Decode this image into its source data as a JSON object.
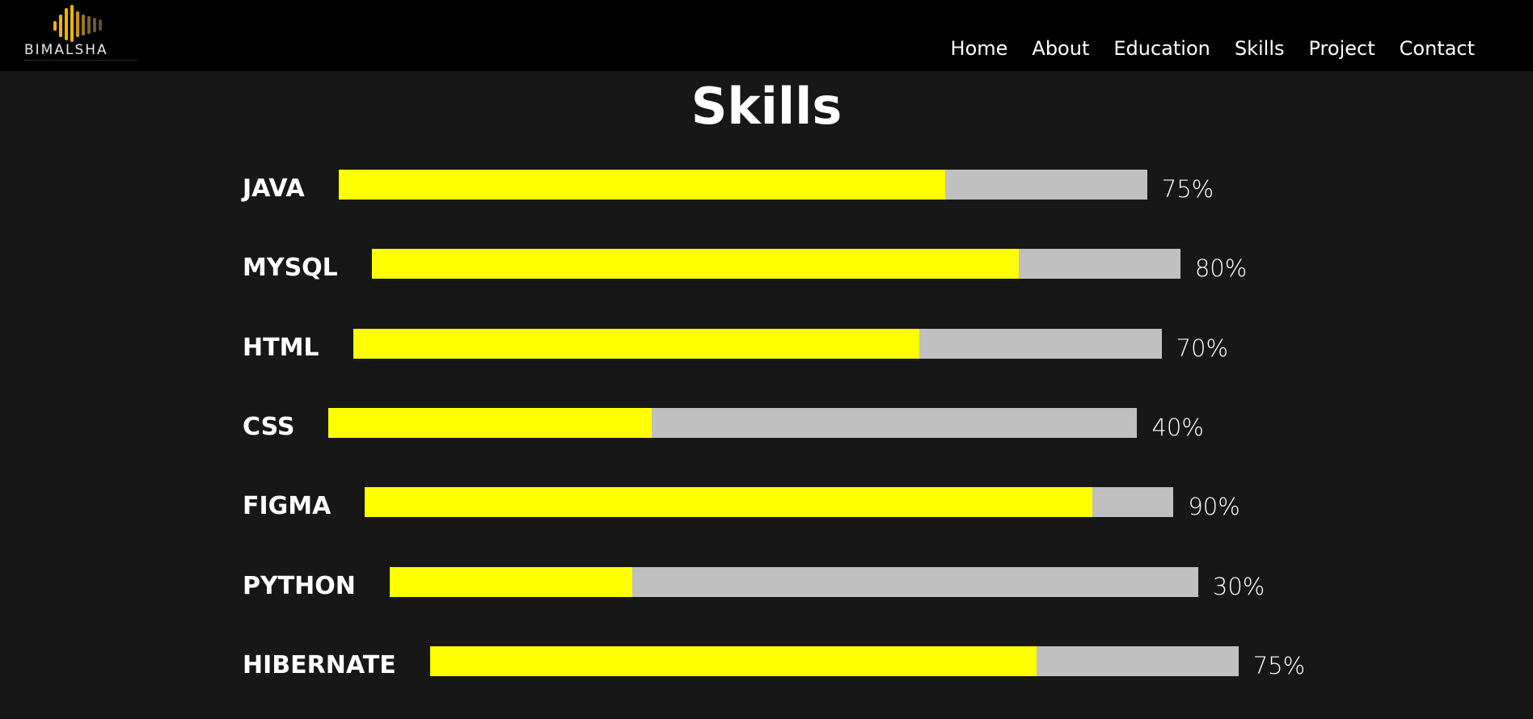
{
  "brand": {
    "name": "BIMALSHA",
    "logo_icon": "soundwave-logo-icon",
    "accent_color": "#f0b400"
  },
  "nav": {
    "items": [
      {
        "label": "Home"
      },
      {
        "label": "About"
      },
      {
        "label": "Education"
      },
      {
        "label": "Skills"
      },
      {
        "label": "Project"
      },
      {
        "label": "Contact"
      }
    ]
  },
  "page": {
    "title": "Skills"
  },
  "skills": [
    {
      "name": "JAVA",
      "percent_label": "75%",
      "level": 0.75
    },
    {
      "name": "MYSQL",
      "percent_label": "80%",
      "level": 0.8
    },
    {
      "name": "HTML",
      "percent_label": "70%",
      "level": 0.7
    },
    {
      "name": "CSS",
      "percent_label": "40%",
      "level": 0.4
    },
    {
      "name": "FIGMA",
      "percent_label": "90%",
      "level": 0.9
    },
    {
      "name": "PYTHON",
      "percent_label": "30%",
      "level": 0.3
    },
    {
      "name": "HIBERNATE",
      "percent_label": "75%",
      "level": 0.75
    }
  ],
  "colors": {
    "background": "#171717",
    "header": "#000000",
    "bar_fill": "#ffff00",
    "bar_track": "#c0c0c0",
    "text": "#ffffff"
  }
}
